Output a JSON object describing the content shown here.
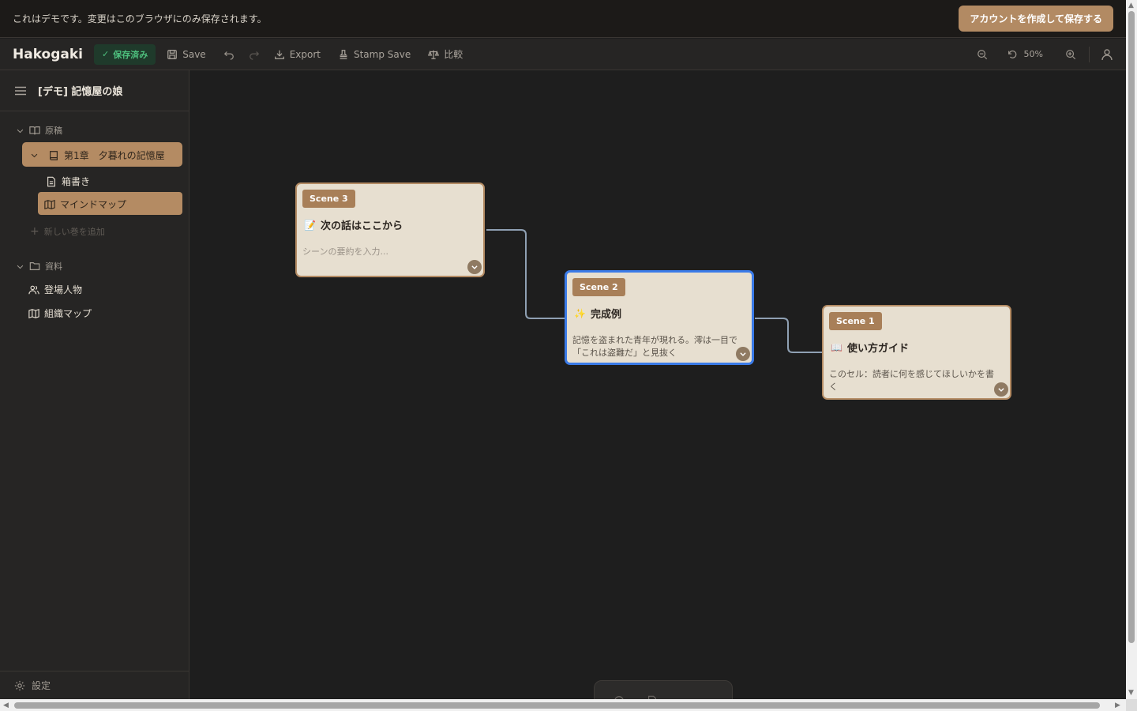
{
  "banner": {
    "text": "これはデモです。変更はこのブラウザにのみ保存されます。",
    "cta": "アカウントを作成して保存する"
  },
  "toolbar": {
    "app_title": "Hakogaki",
    "saved": "保存済み",
    "save": "Save",
    "export": "Export",
    "stamp_save": "Stamp Save",
    "compare": "比較",
    "zoom": "50%"
  },
  "sidebar": {
    "project_title": "[デモ] 記憶屋の娘",
    "manuscript": "原稿",
    "chapter": "第1章　夕暮れの記憶屋",
    "hakogaki": "箱書き",
    "mindmap": "マインドマップ",
    "add_volume": "新しい巻を追加",
    "materials": "資料",
    "characters": "登場人物",
    "org_map": "組織マップ",
    "settings": "設定"
  },
  "cards": [
    {
      "tag": "Scene 3",
      "icon": "📝",
      "title": "次の話はここから",
      "summary": "シーンの要約を入力..."
    },
    {
      "tag": "Scene 2",
      "icon": "✨",
      "title": "完成例",
      "summary": "記憶を盗まれた青年が現れる。澪は一目で「これは盗難だ」と見抜く"
    },
    {
      "tag": "Scene 1",
      "icon": "📖",
      "title": "使い方ガイド",
      "summary": "このセル：読者に何を感じてほしいかを書く"
    }
  ],
  "colors": {
    "accent": "#b48b63",
    "selection": "#3b7be8",
    "saved_green": "#4ec07e"
  }
}
